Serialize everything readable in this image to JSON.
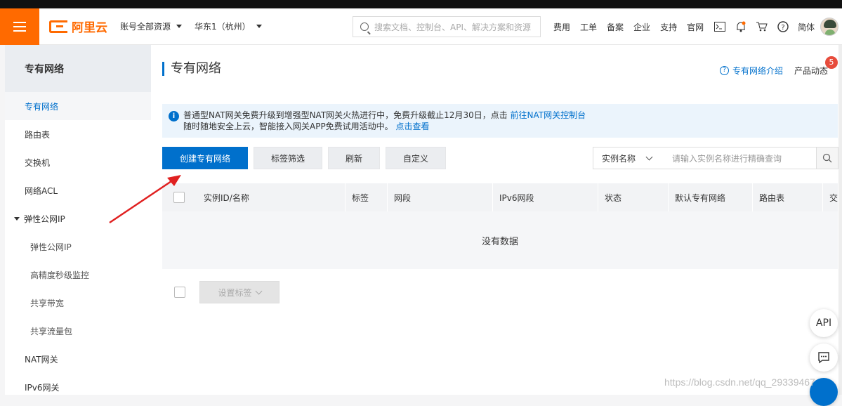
{
  "topbar": {
    "brand": "阿里云",
    "account_dropdown": "账号全部资源",
    "region_dropdown": "华东1（杭州）",
    "search_placeholder": "搜索文档、控制台、API、解决方案和资源",
    "links": [
      "费用",
      "工单",
      "备案",
      "企业",
      "支持",
      "官网"
    ],
    "language": "简体"
  },
  "sidebar": {
    "title": "专有网络",
    "items": [
      {
        "label": "专有网络",
        "active": true
      },
      {
        "label": "路由表"
      },
      {
        "label": "交换机"
      },
      {
        "label": "网络ACL"
      },
      {
        "label": "弹性公网IP",
        "expanded": true
      },
      {
        "label": "弹性公网IP",
        "sub": true
      },
      {
        "label": "高精度秒级监控",
        "sub": true
      },
      {
        "label": "共享带宽",
        "sub": true
      },
      {
        "label": "共享流量包",
        "sub": true
      },
      {
        "label": "NAT网关"
      },
      {
        "label": "IPv6网关"
      }
    ]
  },
  "page": {
    "title": "专有网络",
    "help_link": "专有网络介绍",
    "product_news": "产品动态",
    "news_badge": "5"
  },
  "notice": {
    "line1": "普通型NAT网关免费升级到增强型NAT网关火热进行中，免费升级截止12月30日，点击",
    "line1_link": "前往NAT网关控制台",
    "line2": "随时随地安全上云，智能接入网关APP免费试用活动中。",
    "line2_link": "点击查看"
  },
  "toolbar": {
    "create": "创建专有网络",
    "tag_filter": "标签筛选",
    "refresh": "刷新",
    "customize": "自定义",
    "filter_field": "实例名称",
    "filter_placeholder": "请输入实例名称进行精确查询"
  },
  "table": {
    "columns": [
      "实例ID/名称",
      "标签",
      "网段",
      "IPv6网段",
      "状态",
      "默认专有网络",
      "路由表",
      "交"
    ],
    "empty_text": "没有数据"
  },
  "footer": {
    "set_tags": "设置标签"
  },
  "floating": {
    "api": "API"
  },
  "watermark": "https://blog.csdn.net/qq_29339467"
}
